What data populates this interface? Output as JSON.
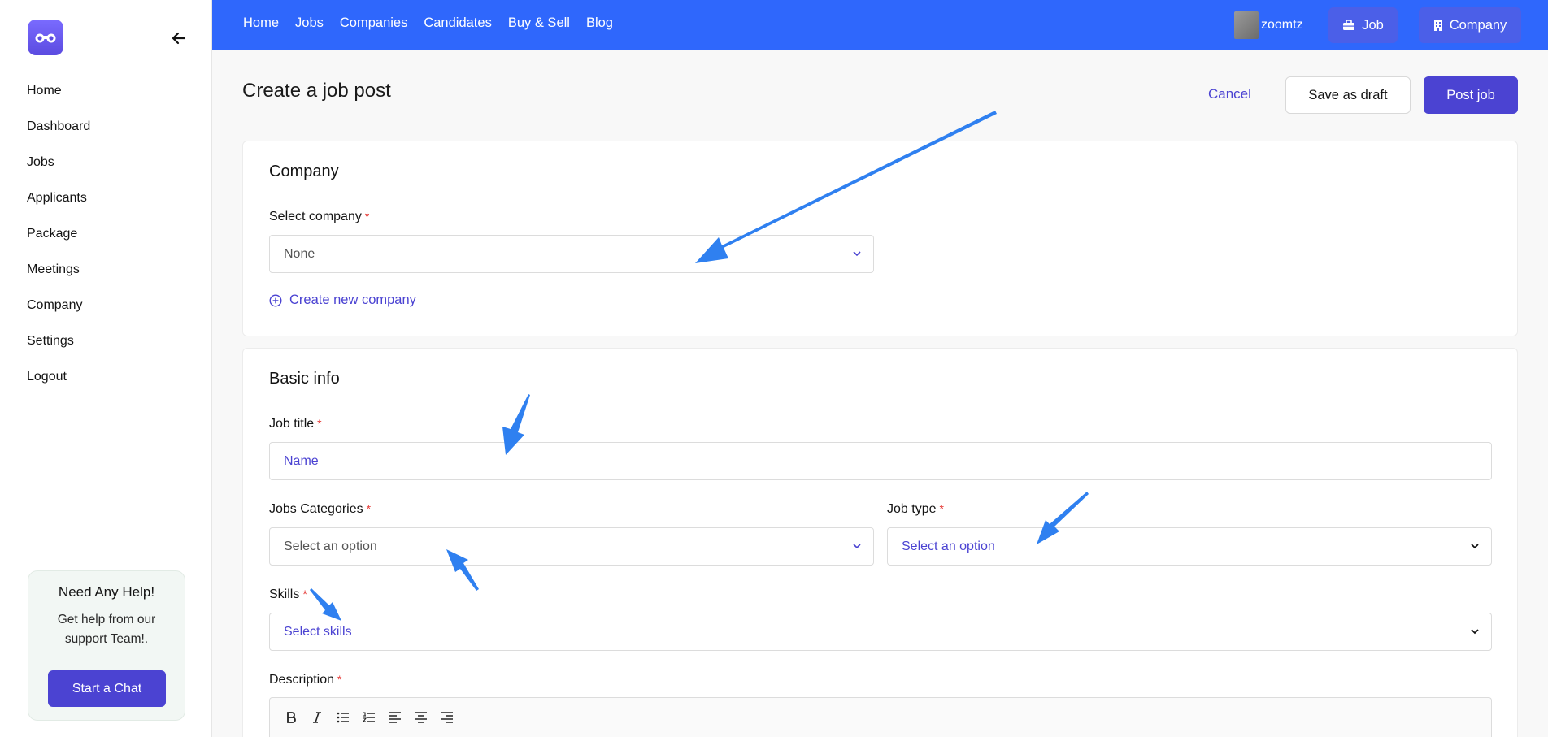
{
  "sidebar": {
    "items": [
      "Home",
      "Dashboard",
      "Jobs",
      "Applicants",
      "Package",
      "Meetings",
      "Company",
      "Settings",
      "Logout"
    ],
    "help": {
      "title": "Need Any Help!",
      "text": "Get help from our support Team!.",
      "button": "Start a Chat"
    }
  },
  "topbar": {
    "nav": [
      "Home",
      "Jobs",
      "Companies",
      "Candidates",
      "Buy & Sell",
      "Blog"
    ],
    "username": "zoomtz",
    "job_button": "Job",
    "company_button": "Company"
  },
  "header": {
    "title": "Create a job post",
    "cancel": "Cancel",
    "save_draft": "Save as draft",
    "post": "Post job"
  },
  "company_section": {
    "title": "Company",
    "select_label": "Select company",
    "select_value": "None",
    "create_link": "Create new company"
  },
  "basic_info": {
    "title": "Basic info",
    "job_title_label": "Job title",
    "job_title_placeholder": "Name",
    "categories_label": "Jobs Categories",
    "categories_value": "Select an option",
    "job_type_label": "Job type",
    "job_type_placeholder": "Select an option",
    "skills_label": "Skills",
    "skills_placeholder": "Select skills",
    "description_label": "Description"
  },
  "required_mark": "*",
  "colors": {
    "topbar": "#2f67fc",
    "accent": "#4b43d2",
    "annotation_arrow": "#2f80f0"
  }
}
